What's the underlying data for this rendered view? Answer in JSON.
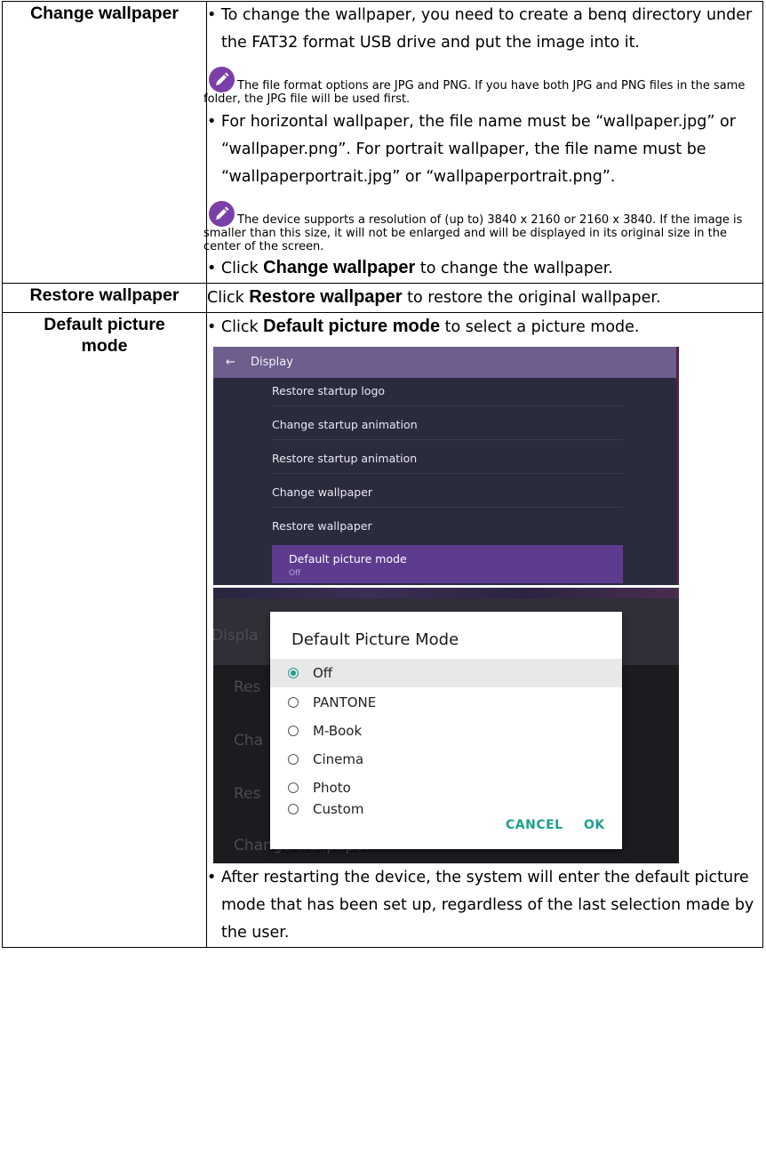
{
  "rows": {
    "change_wallpaper": {
      "label": "Change wallpaper",
      "bullet1": "• To change the wallpaper, you need to create a benq directory under the FAT32 format USB drive and put the image into it.",
      "note1": "The file format options are JPG and PNG. If you have both JPG and PNG files in the same folder, the JPG file will be used first.",
      "bullet2": "• For horizontal wallpaper, the file name must be “wallpaper.jpg” or “wallpaper.png”. For portrait wallpaper, the file name must be “wallpaperportrait.jpg” or “wallpaperportrait.png”.",
      "note2": "The device supports a resolution of (up to) 3840 x 2160 or 2160 x 3840. If the image is smaller than this size, it will not be enlarged and will be displayed in its original size in the center of the screen.",
      "bullet3_pre": "• Click ",
      "bullet3_bold": "Change wallpaper",
      "bullet3_post": " to change the wallpaper."
    },
    "restore_wallpaper": {
      "label": "Restore wallpaper",
      "pre": "Click ",
      "bold": "Restore wallpaper",
      "post": " to restore the original wallpaper."
    },
    "default_picture_mode": {
      "label": "Default picture mode",
      "bullet1_pre": "• Click ",
      "bullet1_bold": "Default picture mode",
      "bullet1_post": " to select a picture mode.",
      "bullet2": "• After restarting the device, the system will enter the default picture mode that has been set up, regardless of the last selection made by the user."
    }
  },
  "screenshot1": {
    "header_title": "Display",
    "items": [
      "Restore startup logo",
      "Change startup animation",
      "Restore startup animation",
      "Change wallpaper",
      "Restore wallpaper"
    ],
    "selected_title": "Default picture mode",
    "selected_value": "Off",
    "accent_color": "#5d3b8f"
  },
  "screenshot2": {
    "background_texts": [
      "Displa",
      "Res",
      "Cha",
      "Res",
      "Change wallpaper"
    ],
    "dialog_title": "Default Picture Mode",
    "options": [
      "Off",
      "PANTONE",
      "M-Book",
      "Cinema",
      "Photo",
      "Custom"
    ],
    "selected_option": "Off",
    "cancel_label": "CANCEL",
    "ok_label": "OK",
    "accent_color": "#1f9e8f"
  },
  "icons": {
    "note": "pencil-icon",
    "back": "arrow-left-icon"
  }
}
